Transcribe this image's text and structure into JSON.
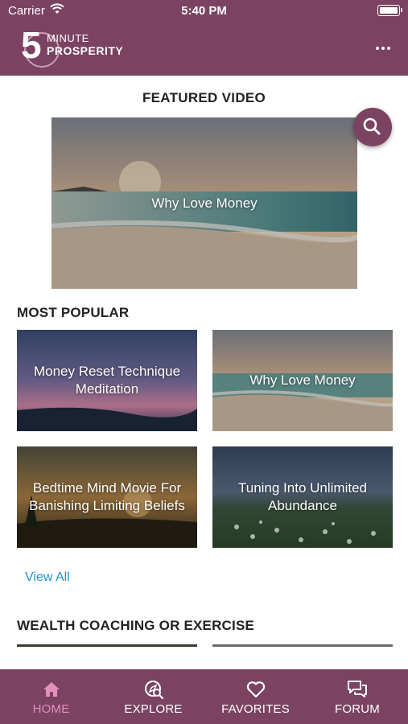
{
  "status_bar": {
    "carrier": "Carrier",
    "time": "5:40 PM"
  },
  "header": {
    "logo_number": "5",
    "logo_line1": "MINUTE",
    "logo_line2": "PROSPERITY",
    "menu_icon": "more-horizontal-icon"
  },
  "featured": {
    "section_title": "FEATURED VIDEO",
    "video_title": "Why Love Money",
    "search_icon": "search-icon"
  },
  "most_popular": {
    "section_title": "MOST POPULAR",
    "items": [
      {
        "title": "Money Reset Technique Meditation"
      },
      {
        "title": "Why Love Money"
      },
      {
        "title": "Bedtime Mind Movie For Banishing Limiting Beliefs"
      },
      {
        "title": "Tuning Into Unlimited Abundance"
      }
    ],
    "view_all": "View All"
  },
  "wealth": {
    "section_title": "WEALTH COACHING OR EXERCISE"
  },
  "tabs": [
    {
      "label": "HOME",
      "icon": "home-icon",
      "active": true
    },
    {
      "label": "EXPLORE",
      "icon": "explore-icon",
      "active": false
    },
    {
      "label": "FAVORITES",
      "icon": "heart-icon",
      "active": false
    },
    {
      "label": "FORUM",
      "icon": "chat-bubbles-icon",
      "active": false
    }
  ],
  "colors": {
    "brand": "#7b4361",
    "active_tab": "#e58ec0",
    "link": "#1f8fd6"
  }
}
